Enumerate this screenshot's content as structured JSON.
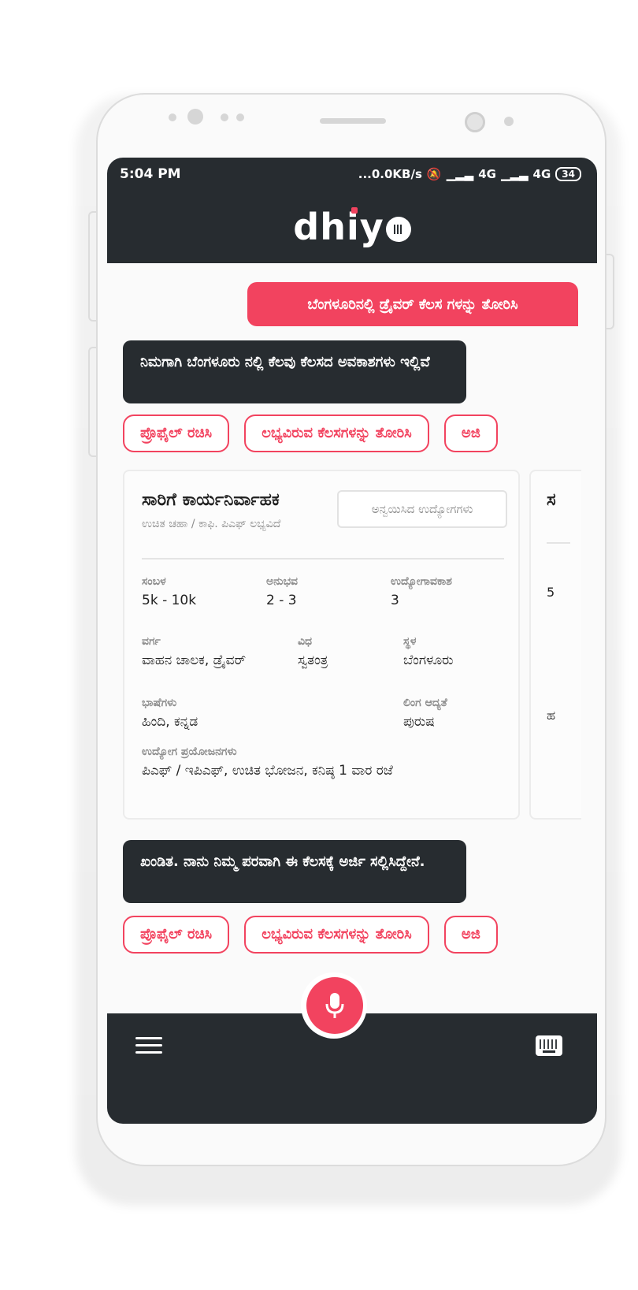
{
  "status_bar": {
    "time": "5:04 PM",
    "network_speed": "...0.0KB/s",
    "signal_1": "4G",
    "signal_2": "4G",
    "battery": "34"
  },
  "app": {
    "logo_text": "dhiy"
  },
  "chat": {
    "user_message": "ಬೆಂಗಳೂರಿನಲ್ಲಿ ಡ್ರೈವರ್ ಕೆಲಸ ಗಳನ್ನು ತೋರಿಸಿ",
    "bot_message_1": "ನಿಮಗಾಗಿ ಬೆಂಗಳೂರು ನಲ್ಲಿ ಕೆಲವು ಕೆಲಸದ ಅವಕಾಶಗಳು ಇಲ್ಲಿವೆ",
    "bot_message_2": "ಖಂಡಿತ. ನಾನು ನಿಮ್ಮ ಪರವಾಗಿ ಈ ಕೆಲಸಕ್ಕೆ ಅರ್ಜಿ ಸಲ್ಲಿಸಿದ್ದೇನೆ.",
    "chips": [
      "ಪ್ರೊಫೈಲ್ ರಚಿಸಿ",
      "ಲಭ್ಯವಿರುವ ಕೆಲಸಗಳನ್ನು ತೋರಿಸಿ",
      "ಅಜಿ"
    ]
  },
  "job_card": {
    "title": "ಸಾರಿಗೆ ಕಾರ್ಯನಿರ್ವಾಹಕ",
    "subtitle": "ಉಚಿತ ಚಹಾ / ಕಾಫಿ. ಪಿಎಫ್ ಲಭ್ಯವಿದೆ",
    "similar_jobs_button": "ಅನ್ವಯಿಸಿದ ಉದ್ಯೋಗಗಳು",
    "salary_label": "ಸಂಬಳ",
    "salary": "5k - 10k",
    "experience_label": "ಅನುಭವ",
    "experience": "2 - 3",
    "openings_label": "ಉದ್ಯೋಗಾವಕಾಶ",
    "openings": "3",
    "category_label": "ವರ್ಗ",
    "category": "ವಾಹನ ಚಾಲಕ, ಡ್ರೈವರ್",
    "type_label": "ವಿಧ",
    "type": "ಸ್ವತಂತ್ರ",
    "location_label": "ಸ್ಥಳ",
    "location": "ಬೆಂಗಳೂರು",
    "languages_label": "ಭಾಷೆಗಳು",
    "languages": "ಹಿಂದಿ, ಕನ್ನಡ",
    "gender_label": "ಲಿಂಗ ಆದ್ಯತೆ",
    "gender": "ಪುರುಷ",
    "benefits_label": "ಉದ್ಯೋಗ ಪ್ರಯೋಜನಗಳು",
    "benefits": "ಪಿಎಫ್ / ಇಪಿಎಫ್, ಉಚಿತ ಭೋಜನ, ಕನಿಷ್ಠ 1 ವಾರ ರಜೆ"
  },
  "job_card_2": {
    "title_char": "ಸ",
    "salary_digit": "5",
    "lang_char": "ಹ"
  },
  "colors": {
    "accent": "#f2435f",
    "dark": "#272c30"
  },
  "icons": {
    "menu": "menu-icon",
    "mic": "mic-icon",
    "keyboard": "keyboard-icon"
  }
}
